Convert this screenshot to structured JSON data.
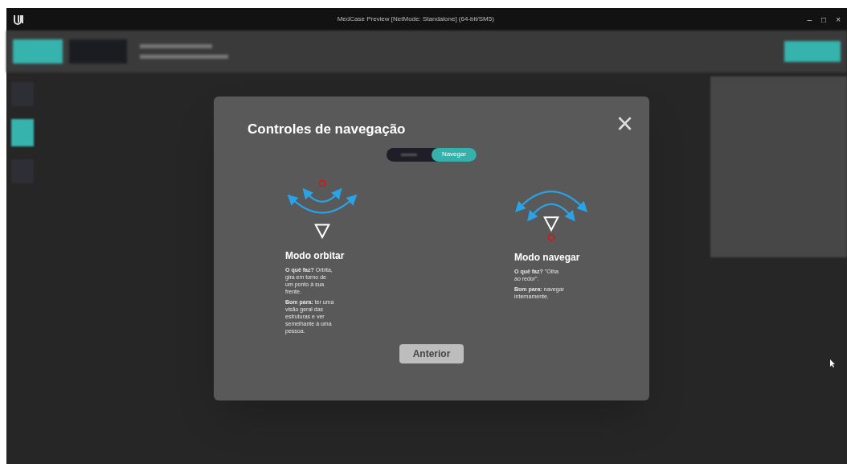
{
  "window": {
    "title": "MedCase Preview [NetMode: Standalone] (64-bit/SM5)",
    "controls": [
      "–",
      "□",
      "×"
    ]
  },
  "dialog": {
    "title": "Controles de navegação",
    "close": "×",
    "toggle": [
      {
        "selected": false
      },
      {
        "label": "Navegar",
        "selected": true
      }
    ],
    "modes": [
      {
        "kind": "orbit",
        "title": "Modo orbitar",
        "paragraphs": [
          "**O quê faz?** Orbita, gira em torno de um ponto à sua frente.",
          "**Bom para:** ter uma visão geral das estruturas e ver semelhante à uma pessoa."
        ]
      },
      {
        "kind": "navigate",
        "title": "Modo navegar",
        "paragraphs": [
          "**O quê faz?** \"Olha ao redor\".",
          "**Bom para:** navegar internamente."
        ]
      }
    ],
    "button": "Anterior"
  }
}
